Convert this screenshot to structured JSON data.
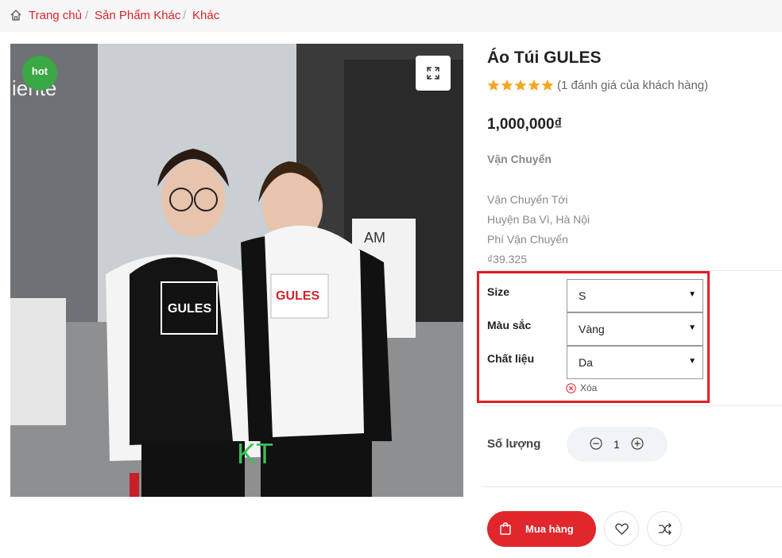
{
  "breadcrumb": {
    "items": [
      "Trang chủ",
      "Sản Phẩm Khác",
      "Khác"
    ],
    "separator": "/"
  },
  "product": {
    "badge": "hot",
    "image_text": {
      "sign": "iente",
      "print_front": "GULES",
      "print_back": "GULES",
      "watermark": "KT",
      "poster": "AM"
    },
    "title": "Áo Túi GULES",
    "rating": 5,
    "rating_max": 5,
    "reviews": "(1 đánh giá của khách hàng)",
    "price": "1,000,000₫"
  },
  "shipping": {
    "label": "Vận Chuyển",
    "to_label": "Vận Chuyển Tới",
    "location": "Huyện Ba Vì, Hà Nội",
    "fee_label": "Phí Vận Chuyển",
    "fee": "₫39.325"
  },
  "options": {
    "size": {
      "label": "Size",
      "value": "S"
    },
    "color": {
      "label": "Màu sắc",
      "value": "Vàng"
    },
    "material": {
      "label": "Chất liệu",
      "value": "Da"
    },
    "clear_label": "Xóa"
  },
  "quantity": {
    "label": "Số lượng",
    "value": "1"
  },
  "actions": {
    "buy_label": "Mua hàng"
  },
  "colors": {
    "accent": "#e0272c",
    "highlight": "#e01e26",
    "badge": "#3aa844",
    "star": "#f5a623"
  }
}
